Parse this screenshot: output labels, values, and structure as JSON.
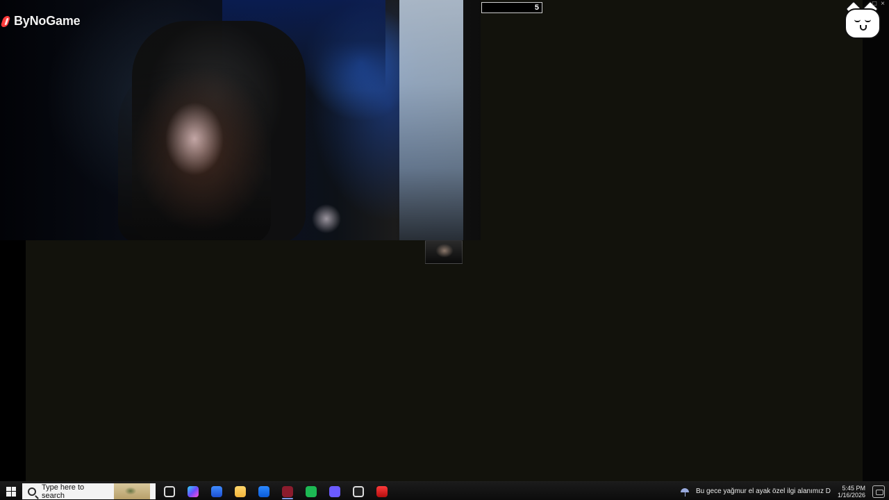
{
  "overlay": {
    "logo_text": "ByNoGame",
    "counter_value": "5"
  },
  "taskbar": {
    "search_placeholder": "Type here to search",
    "tray_message": "Bu gece yağmur el ayak özel ilgi alanımız D",
    "time": "5:45 PM",
    "date": "1/16/2026"
  }
}
